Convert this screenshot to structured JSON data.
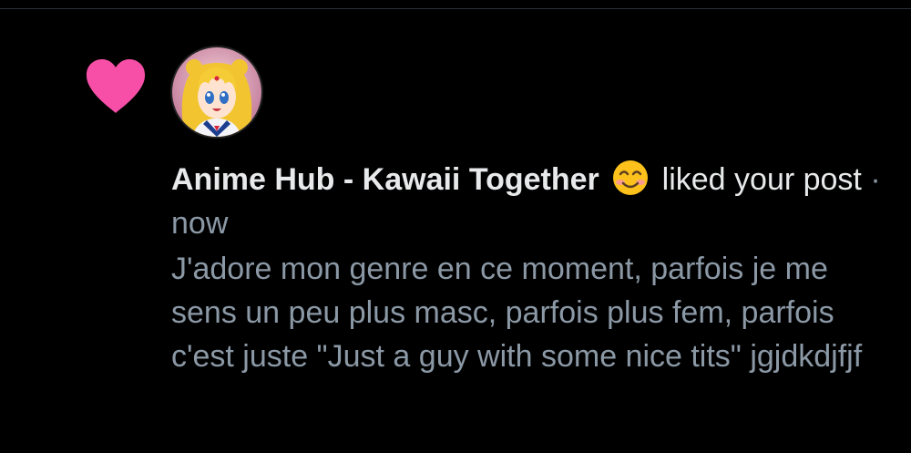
{
  "notification": {
    "type_icon": "heart-icon",
    "heart_color": "#f74fa7",
    "avatar_alt": "profile picture",
    "actor_name": "Anime Hub - Kawaii Together",
    "emoji": "smiling-face-emoji",
    "action_text": "liked your post",
    "separator": "·",
    "timestamp": "now",
    "post_excerpt": "J'adore mon genre en ce moment, parfois je me sens un peu plus masc, parfois plus fem, parfois c'est juste \"Just a guy with some nice tits\" jgjdkdjfjf"
  },
  "colors": {
    "background": "#000000",
    "primary_text": "#e7e9ea",
    "secondary_text": "#8b98a5"
  }
}
